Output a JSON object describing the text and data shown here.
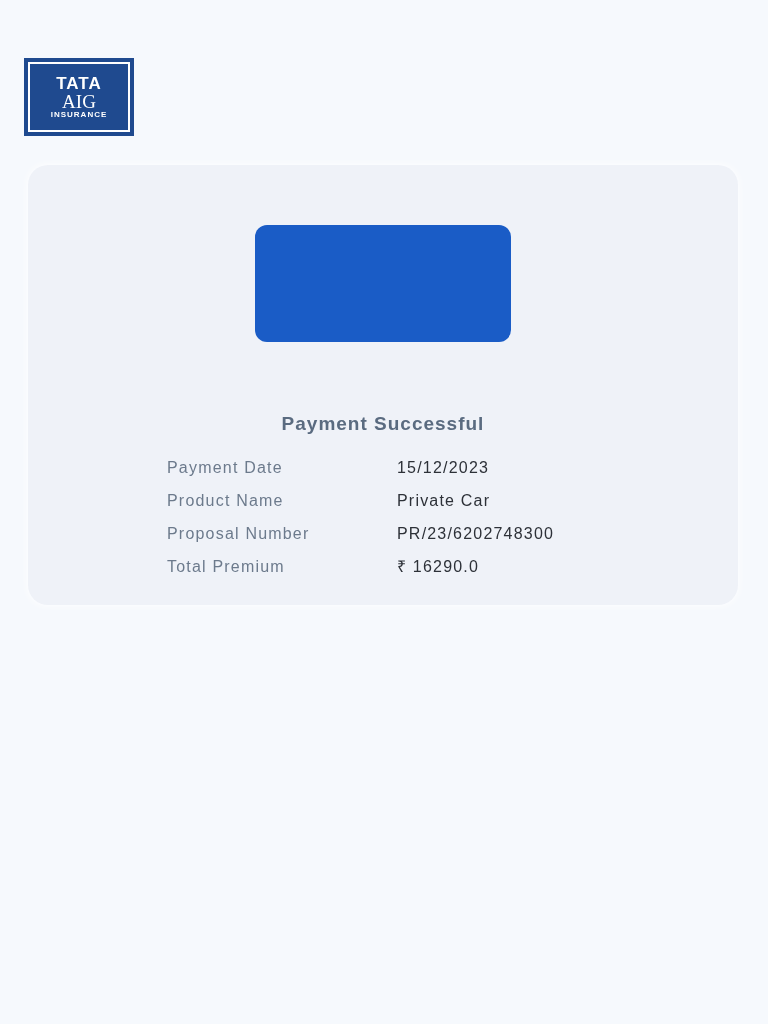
{
  "logo": {
    "lines": [
      "TATA",
      "AIG",
      "INSURANCE"
    ]
  },
  "status": {
    "title": "Payment Successful"
  },
  "details": [
    {
      "label": "Payment Date",
      "value": "15/12/2023"
    },
    {
      "label": "Product Name",
      "value": "Private Car"
    },
    {
      "label": "Proposal Number",
      "value": "PR/23/6202748300"
    },
    {
      "label": "Total Premium",
      "value": "₹ 16290.0"
    }
  ]
}
